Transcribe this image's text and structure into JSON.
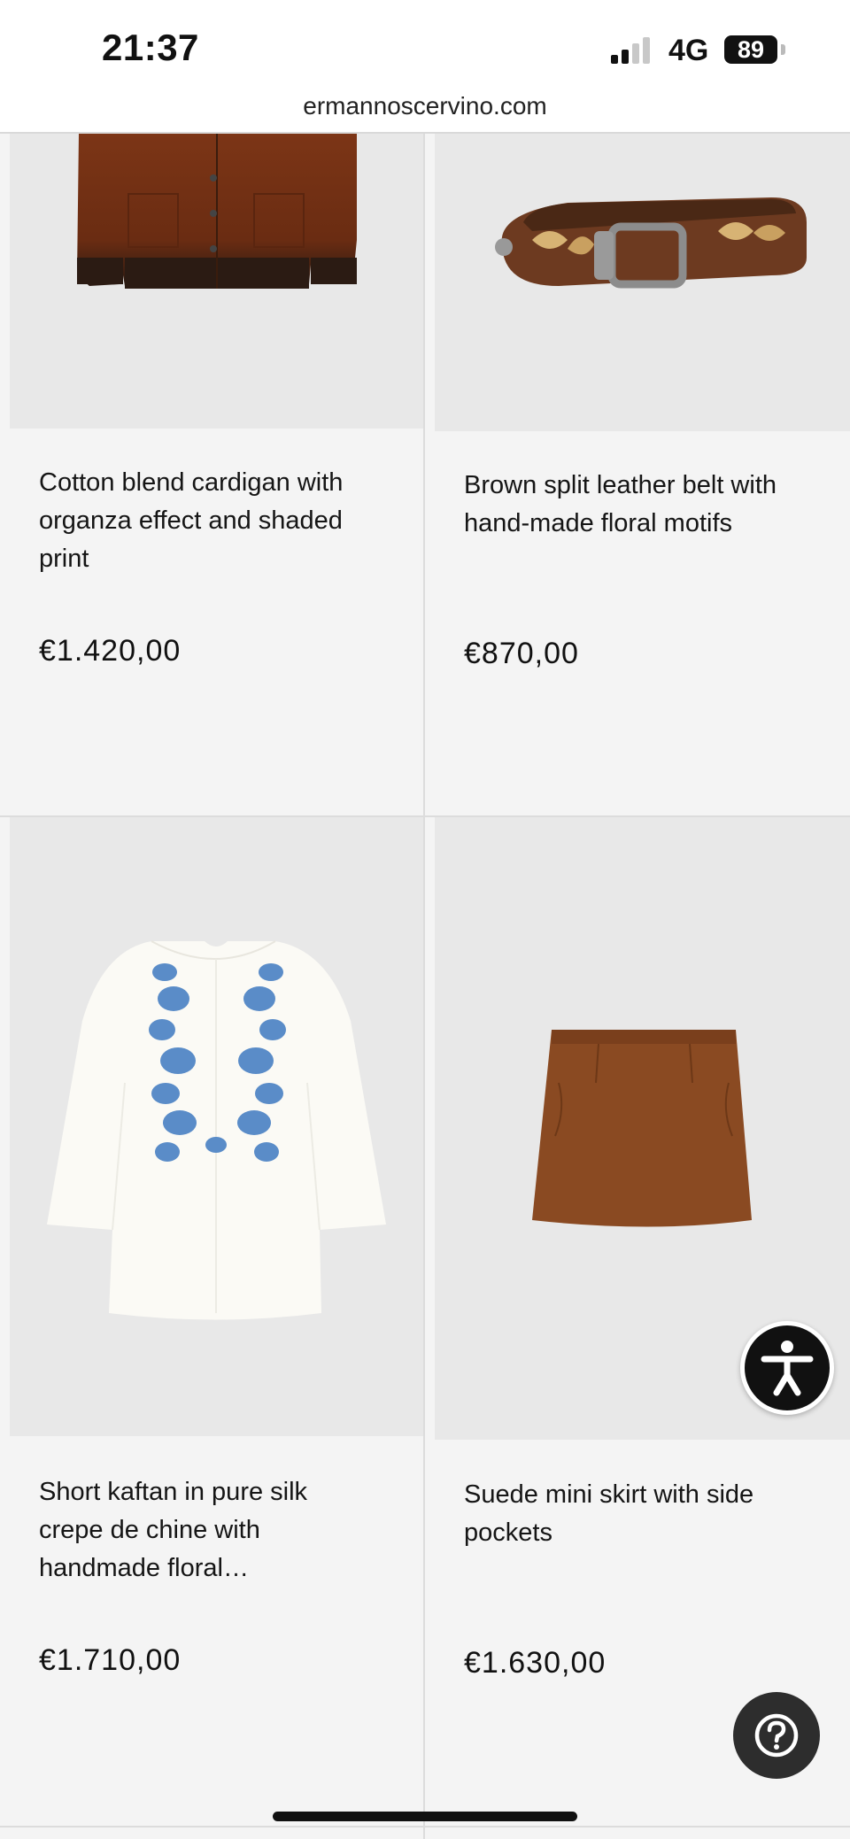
{
  "status_bar": {
    "time": "21:37",
    "network": "4G",
    "battery": "89"
  },
  "browser": {
    "url": "ermannoscervino.com"
  },
  "products": [
    {
      "name": "Cotton blend cardigan with organza effect and shaded print",
      "price": "€1.420,00",
      "image": "brown-cardigan"
    },
    {
      "name": "Brown split leather belt with hand-made floral motifs",
      "price": "€870,00",
      "image": "brown-leather-belt"
    },
    {
      "name": "Short kaftan in pure silk crepe de chine with handmade floral…",
      "price": "€1.710,00",
      "image": "white-kaftan-blue-embroidery"
    },
    {
      "name": "Suede mini skirt with side pockets",
      "price": "€1.630,00",
      "image": "brown-suede-skirt"
    }
  ],
  "floating": {
    "accessibility_icon": "accessibility-person-icon",
    "help_icon": "question-mark-icon"
  },
  "colors": {
    "card_bg": "#f4f4f4",
    "image_bg": "#e8e8e8",
    "cardigan": "#7a3518",
    "skirt": "#8a4a22",
    "embroidery": "#5a8cc8"
  }
}
